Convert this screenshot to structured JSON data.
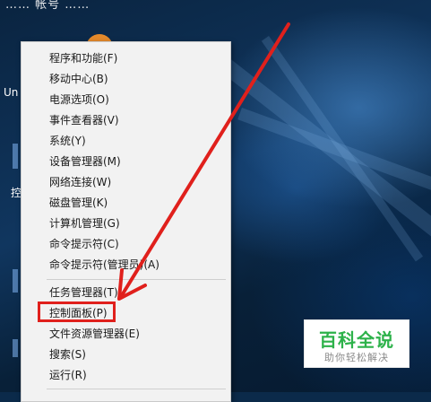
{
  "desktop": {
    "top_text": "…… 帐号 ……",
    "icon_label_un": "Un",
    "icon_label_kong": "控"
  },
  "context_menu": {
    "group1": [
      {
        "label": "程序和功能(F)"
      },
      {
        "label": "移动中心(B)"
      },
      {
        "label": "电源选项(O)"
      },
      {
        "label": "事件查看器(V)"
      },
      {
        "label": "系统(Y)"
      },
      {
        "label": "设备管理器(M)"
      },
      {
        "label": "网络连接(W)"
      },
      {
        "label": "磁盘管理(K)"
      },
      {
        "label": "计算机管理(G)"
      },
      {
        "label": "命令提示符(C)"
      },
      {
        "label": "命令提示符(管理员)(A)"
      }
    ],
    "group2": [
      {
        "label": "任务管理器(T)"
      },
      {
        "label": "控制面板(P)"
      },
      {
        "label": "文件资源管理器(E)"
      },
      {
        "label": "搜索(S)"
      },
      {
        "label": "运行(R)"
      }
    ],
    "highlighted_item": "控制面板(P)"
  },
  "annotation": {
    "arrow_color": "#e0201c"
  },
  "watermark": {
    "title": "百科全说",
    "subtitle": "助你轻松解决",
    "title_color": "#2db24a"
  }
}
